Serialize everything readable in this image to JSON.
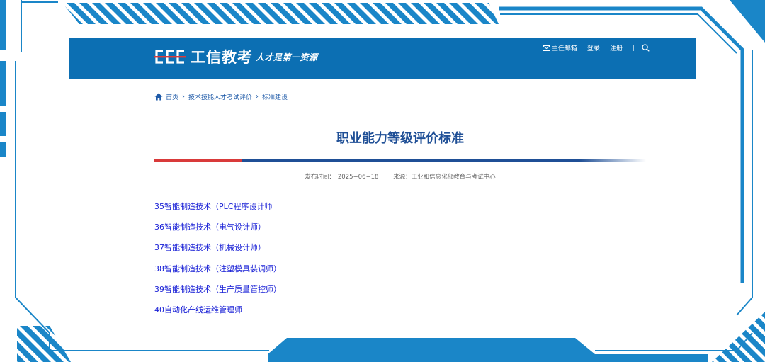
{
  "header": {
    "logo_text": "工信教考",
    "slogan": "人才是第一资源",
    "nav": {
      "mail": "主任邮箱",
      "login": "登录",
      "register": "注册",
      "separator": "|"
    }
  },
  "breadcrumb": {
    "items": [
      "首页",
      "技术技能人才考试评价",
      "标准建设"
    ]
  },
  "article": {
    "title": "职业能力等级评价标准",
    "meta": {
      "date_label": "发布时间：",
      "date": "2025−06−18",
      "source_label": "来源：",
      "source": "工业和信息化部教育与考试中心"
    },
    "links": [
      "35智能制造技术（PLC程序设计师",
      "36智能制造技术（电气设计师）",
      "37智能制造技术（机械设计师）",
      "38智能制造技术（注塑模具装调师）",
      "39智能制造技术（生产质量管控师）",
      "40自动化产线运维管理师"
    ]
  },
  "colors": {
    "header_bg": "#0c6fb3",
    "frame_blue": "#1a86c8",
    "title_blue": "#1f4f96",
    "accent_red": "#d93a3a",
    "link_blue": "#1a21d6"
  }
}
